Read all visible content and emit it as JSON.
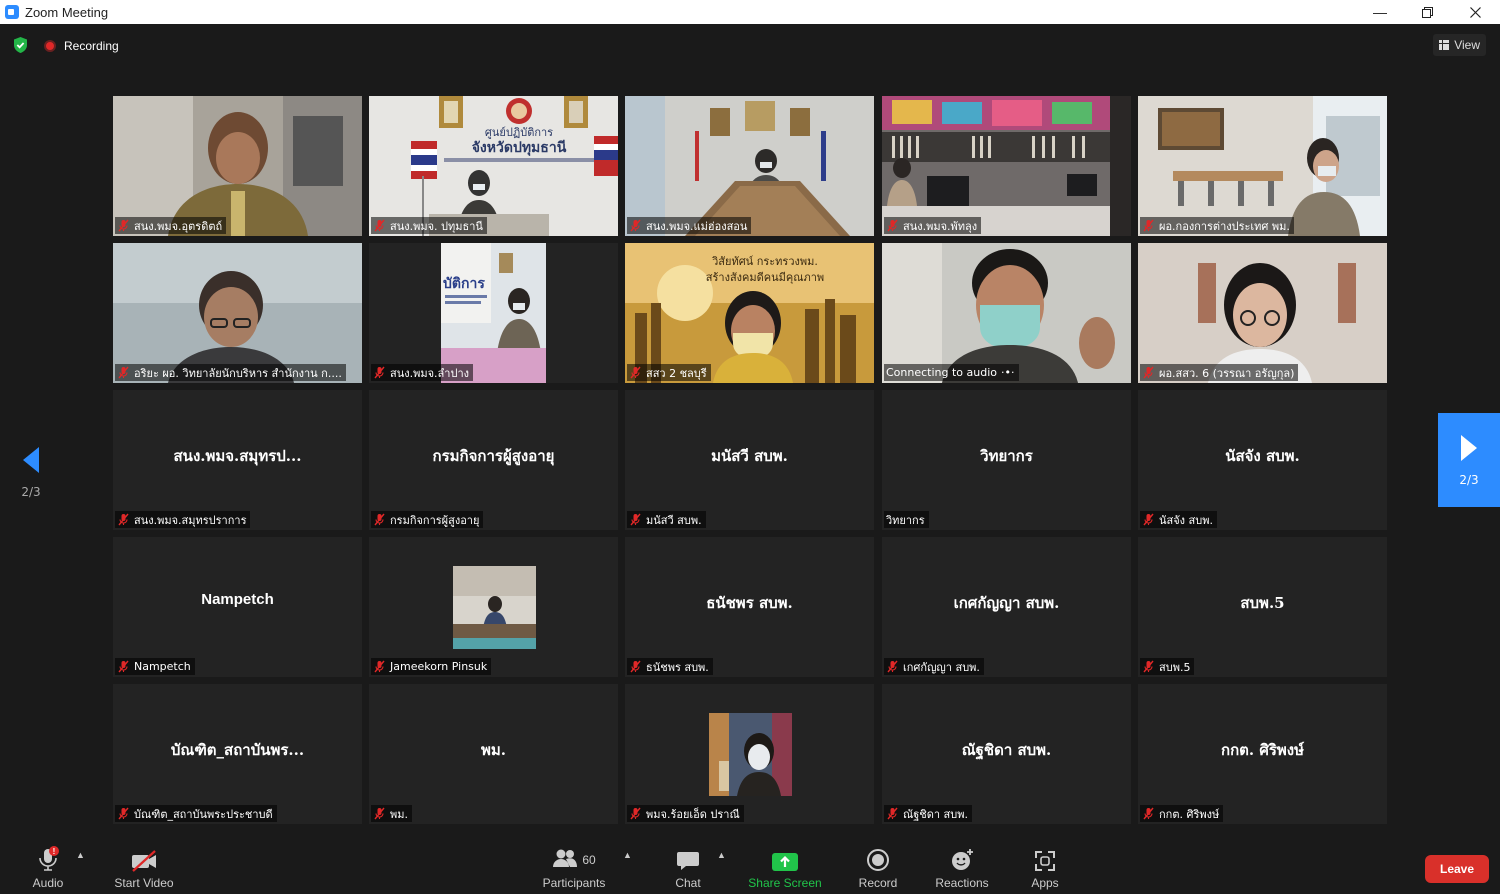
{
  "window": {
    "title": "Zoom Meeting"
  },
  "topbar": {
    "recording_label": "Recording",
    "view_label": "View"
  },
  "pagination": {
    "left_page": "2/3",
    "right_page": "2/3"
  },
  "tiles": [
    {
      "label": "สนง.พมจ.อุตรดิตถ์"
    },
    {
      "label": "สนง.พมจ. ปทุมธานี"
    },
    {
      "label": "สนง.พมจ.แม่ฮ่องสอน"
    },
    {
      "label": "สนง.พมจ.พัทลุง"
    },
    {
      "label": "ผอ.กองการต่างประเทศ พม."
    },
    {
      "label": "อริยะ ผอ. วิทยาลัยนักบริหาร สำนักงาน ก...."
    },
    {
      "label": "สนง.พมจ.ลำปาง"
    },
    {
      "label": "สสว 2 ชลบุรี"
    },
    {
      "label": "Connecting to audio"
    },
    {
      "label": "ผอ.สสว. 6 (วรรณา อรัญกุล)"
    },
    {
      "name": "สนง.พมจ.สมุทรป...",
      "label": "สนง.พมจ.สมุทรปราการ"
    },
    {
      "name": "กรมกิจการผู้สูงอายุ",
      "label": "กรมกิจการผู้สูงอายุ"
    },
    {
      "name": "มนัสวี สบพ.",
      "label": "มนัสวี สบพ."
    },
    {
      "name": "วิทยากร",
      "label": "วิทยากร"
    },
    {
      "name": "นัสจัง สบพ.",
      "label": "นัสจัง สบพ."
    },
    {
      "name": "Nampetch",
      "label": "Nampetch"
    },
    {
      "label": "Jameekorn Pinsuk"
    },
    {
      "name": "ธนัชพร สบพ.",
      "label": "ธนัชพร สบพ."
    },
    {
      "name": "เกศกัญญา สบพ.",
      "label": "เกศกัญญา สบพ."
    },
    {
      "name": "สบพ.5",
      "label": "สบพ.5"
    },
    {
      "name": "บัณฑิต_สถาบันพร...",
      "label": "บัณฑิต_สถาบันพระประชาบดี"
    },
    {
      "name": "พม.",
      "label": "พม."
    },
    {
      "label": "พมจ.ร้อยเอ็ด ปราณี"
    },
    {
      "name": "ณัฐชิดา สบพ.",
      "label": "ณัฐชิดา สบพ."
    },
    {
      "name": "กกต. ศิริพงษ์",
      "label": "กกต. ศิริพงษ์"
    }
  ],
  "toolbar": {
    "audio": "Audio",
    "start_video": "Start Video",
    "participants": "Participants",
    "participants_count": "60",
    "chat": "Chat",
    "share_screen": "Share Screen",
    "record": "Record",
    "reactions": "Reactions",
    "apps": "Apps",
    "leave": "Leave"
  },
  "colors": {
    "accent": "#2d8cff",
    "share_green": "#21c44a",
    "leave_red": "#d9302a",
    "muted_red": "#e02828"
  }
}
